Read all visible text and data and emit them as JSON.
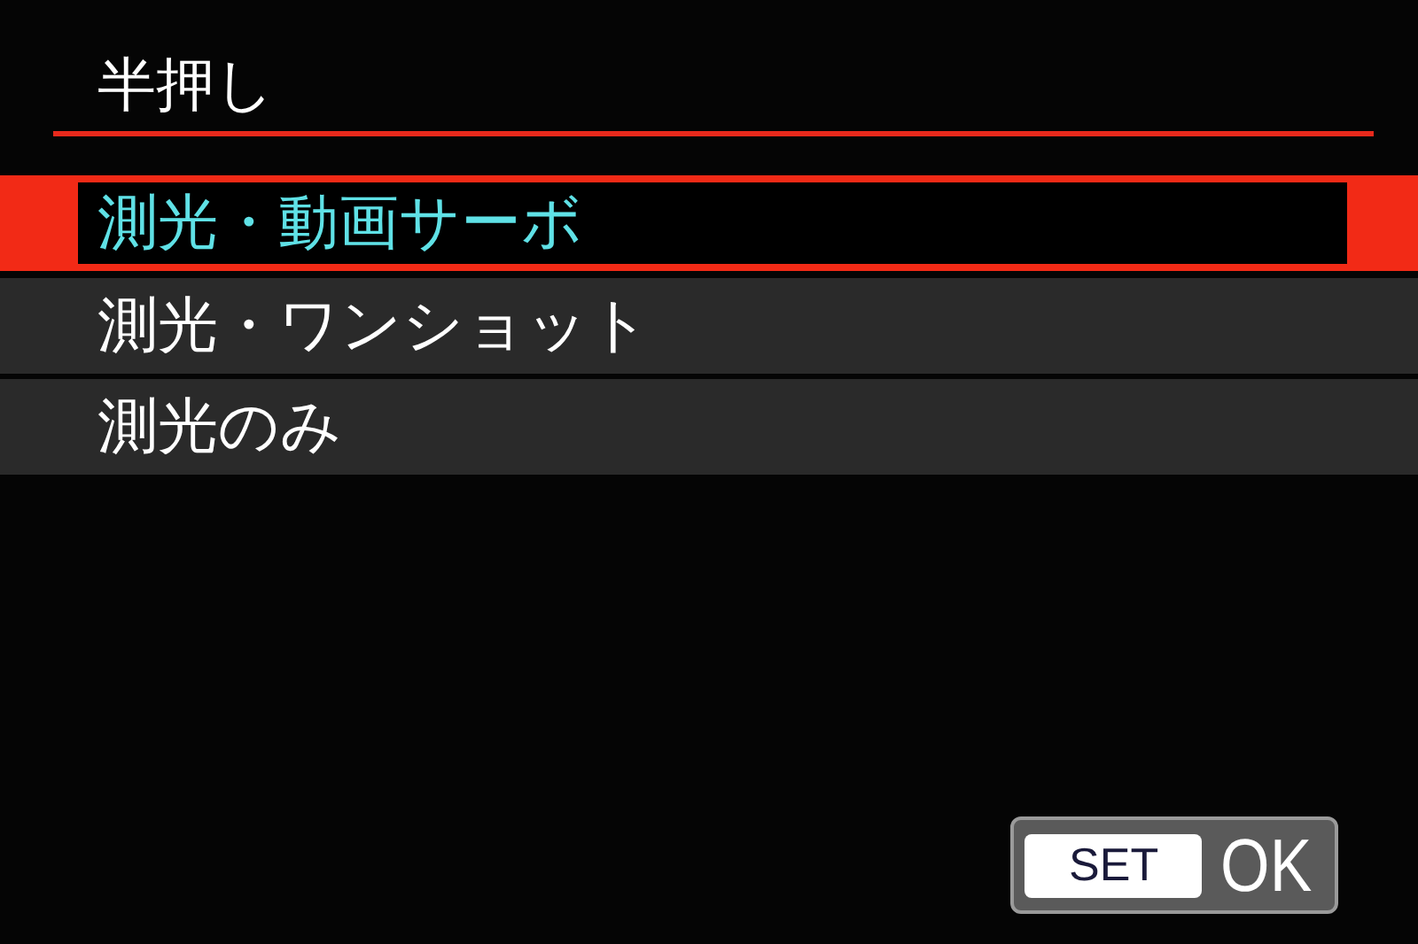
{
  "title": "半押し",
  "options": [
    {
      "label": "測光・動画サーボ",
      "selected": true
    },
    {
      "label": "測光・ワンショット",
      "selected": false
    },
    {
      "label": "測光のみ",
      "selected": false
    }
  ],
  "ok_button": {
    "key": "SET",
    "label": "OK"
  }
}
